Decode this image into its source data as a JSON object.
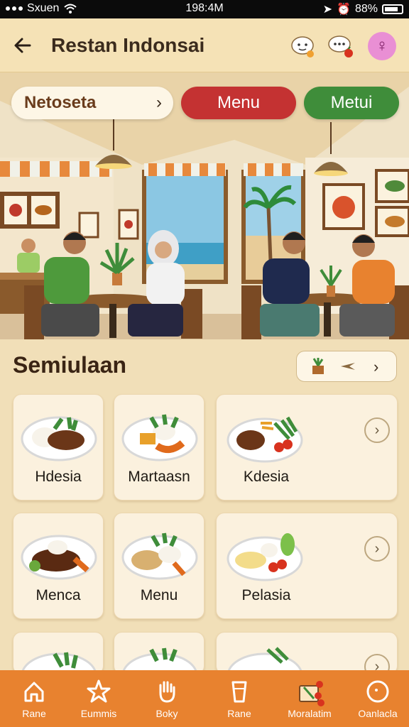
{
  "status_bar": {
    "carrier": "Sxuen",
    "time": "198:4M",
    "battery": "88%"
  },
  "header": {
    "title": "Restan Indonsai"
  },
  "hero": {
    "search_label": "Netoseta",
    "menu_button": "Menu",
    "metui_button": "Metui"
  },
  "section": {
    "title": "Semiulaan"
  },
  "dishes": [
    {
      "label": "Hdesia"
    },
    {
      "label": "Martaasn"
    },
    {
      "label": "Kdesia"
    },
    {
      "label": "Menca"
    },
    {
      "label": "Menu"
    },
    {
      "label": "Pelasia"
    },
    {
      "label": ""
    },
    {
      "label": ""
    },
    {
      "label": ""
    }
  ],
  "bottom_nav": [
    {
      "label": "Rane",
      "icon": "home-icon"
    },
    {
      "label": "Eummis",
      "icon": "star-icon"
    },
    {
      "label": "Boky",
      "icon": "hand-icon"
    },
    {
      "label": "Rane",
      "icon": "glass-icon"
    },
    {
      "label": "Moralatim",
      "icon": "basket-icon"
    },
    {
      "label": "Oanlacla",
      "icon": "circle-icon"
    }
  ],
  "colors": {
    "header_bg": "#f5e2b6",
    "menu_button": "#c43232",
    "metui_button": "#3f8d3a",
    "bottom_nav": "#e8822f",
    "profile": "#e98fd4"
  }
}
